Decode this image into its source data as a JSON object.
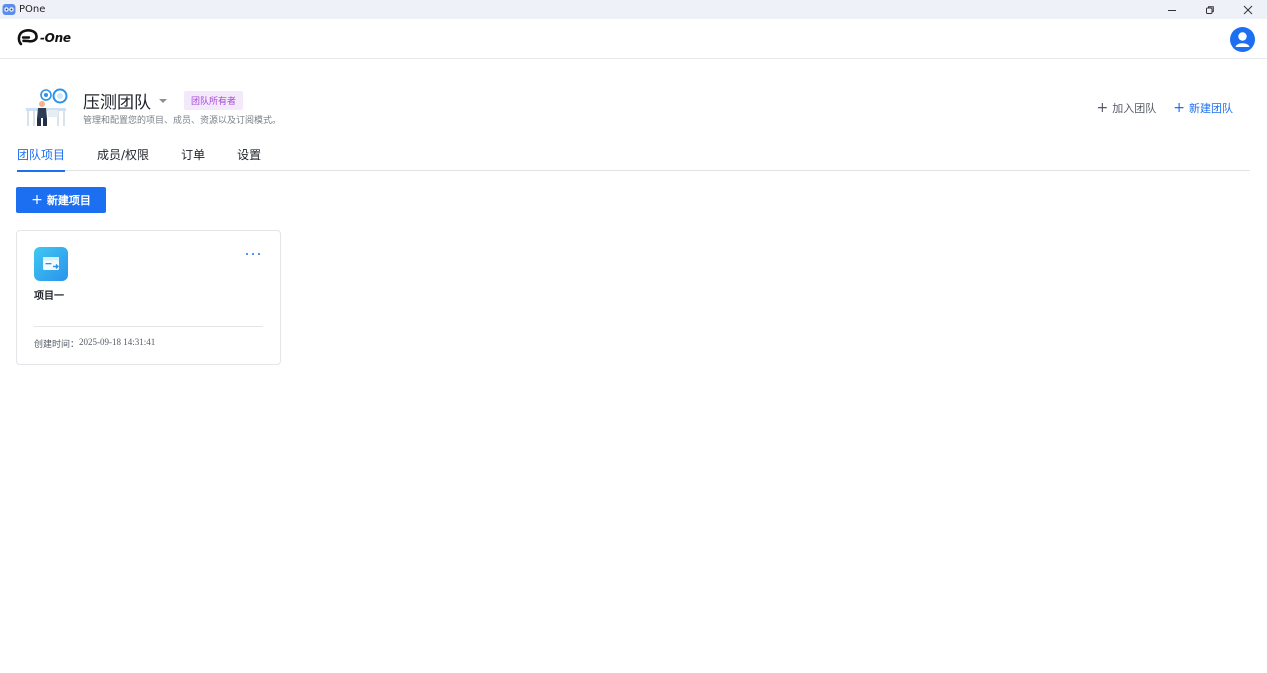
{
  "window": {
    "title": "POne",
    "icons": {
      "app": "app-icon",
      "minimize": "minimize-icon",
      "restore": "restore-icon",
      "close": "close-icon"
    }
  },
  "header": {
    "logo_text": "-One",
    "avatar_icon": "user-avatar-icon"
  },
  "team": {
    "name": "压测团队",
    "role_badge": "团队所有者",
    "description": "管理和配置您的项目、成员、资源以及订阅模式。",
    "actions": {
      "join_label": "加入团队",
      "new_label": "新建团队",
      "plus": "+"
    }
  },
  "tabs": [
    {
      "label": "团队项目",
      "active": true
    },
    {
      "label": "成员/权限",
      "active": false
    },
    {
      "label": "订单",
      "active": false
    },
    {
      "label": "设置",
      "active": false
    }
  ],
  "toolbar": {
    "new_project_plus": "+",
    "new_project_label": "新建项目"
  },
  "projects": [
    {
      "name": "项目一",
      "created_label": "创建时间：",
      "created_time": "2025-09-18 14:31:41",
      "icon": "project-folder-icon",
      "more_icon": "more-icon"
    }
  ],
  "colors": {
    "accent": "#1d6ff2",
    "badge_bg": "#f4e8fb",
    "badge_text": "#a347d8",
    "titlebar_bg": "#eef2f8"
  }
}
